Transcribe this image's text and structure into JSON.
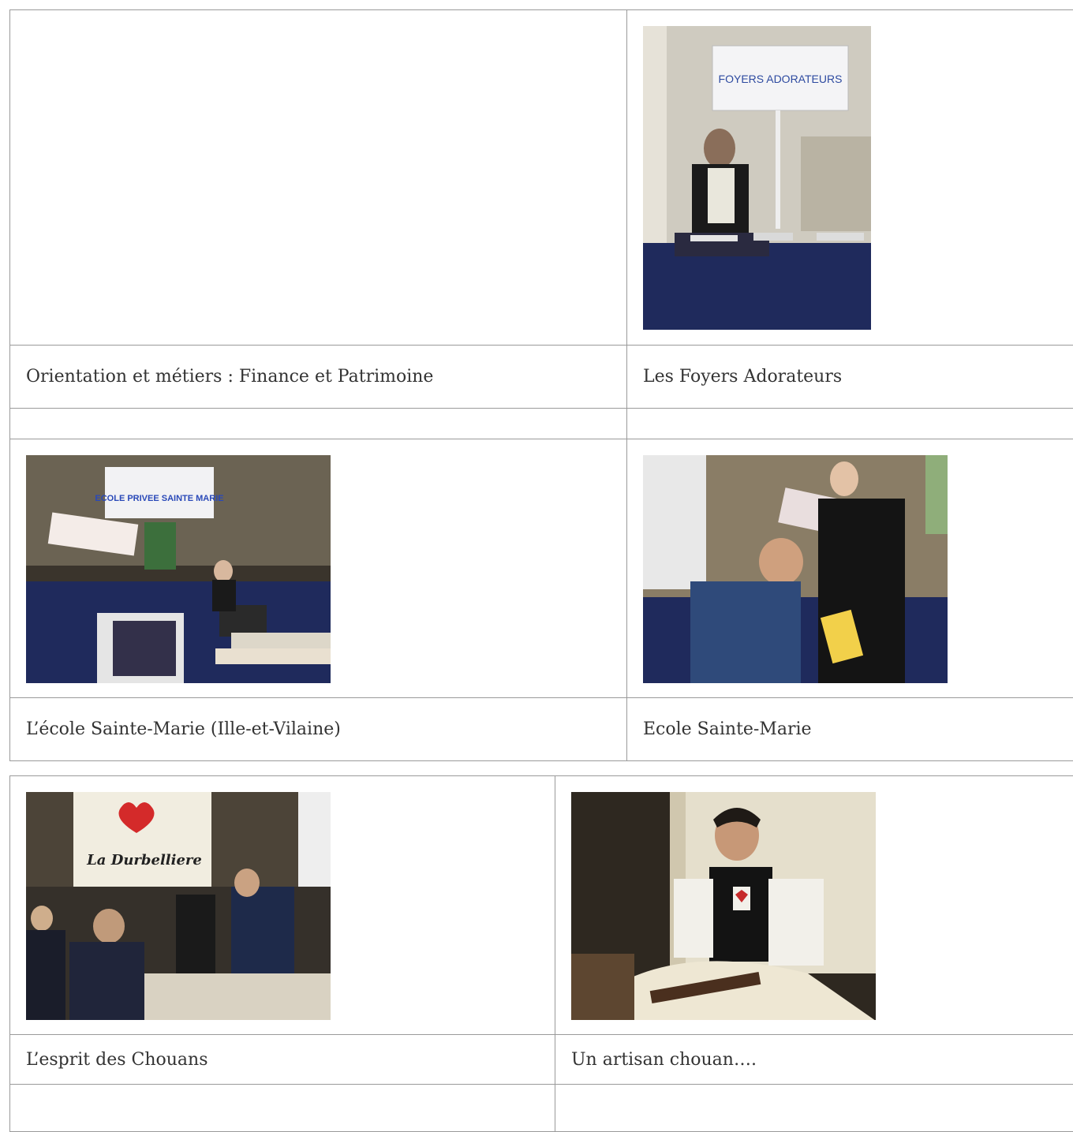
{
  "colors": {
    "border": "#9a9a9a",
    "text": "#333333",
    "table_navy": "#1f2a5c"
  },
  "table1": {
    "rows": [
      {
        "left": {
          "photo": null
        },
        "right": {
          "photo": "foyers-adorateurs-photo",
          "sign_text": "FOYERS ADORATEURS"
        }
      }
    ],
    "captions_row1": {
      "left": "Orientation et métiers : Finance et Patrimoine",
      "right": "Les Foyers Adorateurs"
    },
    "photos_row2": {
      "left": {
        "photo": "ecole-privee-photo",
        "sign_text": "ECOLE PRIVEE SAINTE MARIE"
      },
      "right": {
        "photo": "ecole-sainte-marie-photo"
      }
    },
    "captions_row2": {
      "left": "L’école Sainte-Marie (Ille-et-Vilaine)",
      "right": "Ecole Sainte-Marie"
    }
  },
  "table2": {
    "photos_row1": {
      "left": {
        "photo": "chouans-photo",
        "banner_text": "La Durbelliere"
      },
      "right": {
        "photo": "artisan-chouan-photo"
      }
    },
    "captions_row1": {
      "left": "L’esprit des Chouans",
      "right": "Un artisan chouan…."
    }
  }
}
